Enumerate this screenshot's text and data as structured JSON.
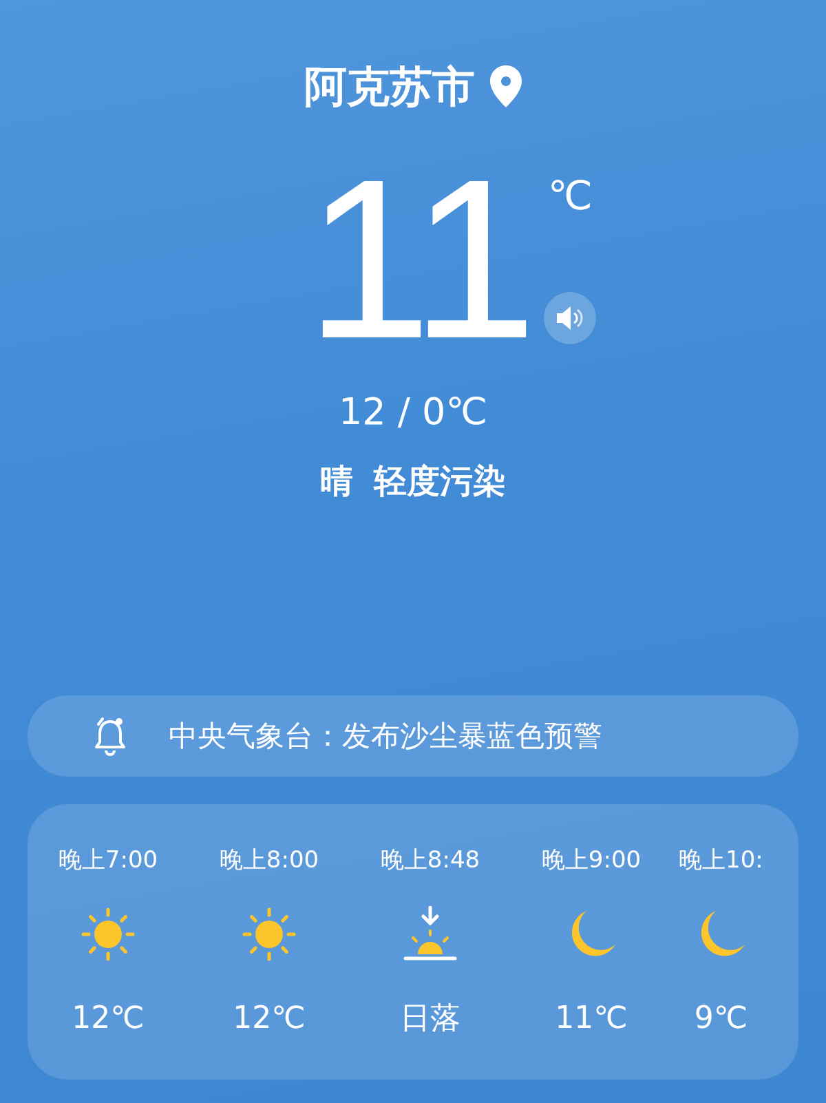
{
  "location": {
    "city": "阿克苏市"
  },
  "current": {
    "temperature": "11",
    "unit": "℃",
    "range": "12 / 0℃",
    "condition": "晴",
    "air_quality": "轻度污染"
  },
  "alert": {
    "text": "中央气象台：发布沙尘暴蓝色预警"
  },
  "hourly": [
    {
      "time": "晚上7:00",
      "kind": "sun",
      "value": "12℃"
    },
    {
      "time": "晚上8:00",
      "kind": "sun",
      "value": "12℃"
    },
    {
      "time": "晚上8:48",
      "kind": "sunset",
      "value": "日落"
    },
    {
      "time": "晚上9:00",
      "kind": "moon",
      "value": "11℃"
    },
    {
      "time": "晚上10:",
      "kind": "moon",
      "value": "9℃"
    }
  ]
}
